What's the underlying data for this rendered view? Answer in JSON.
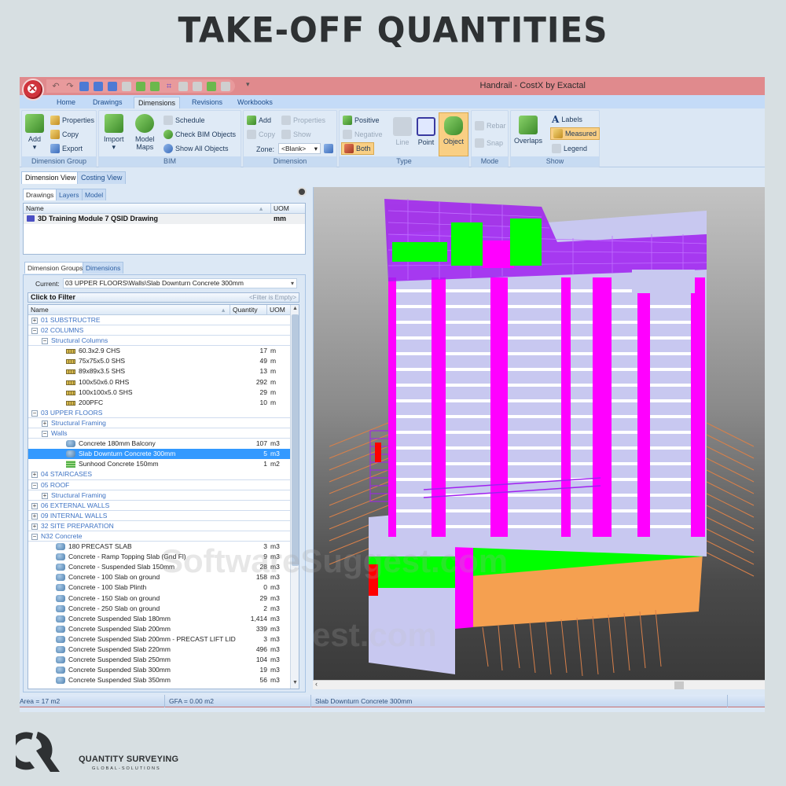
{
  "page": {
    "title": "TAKE-OFF QUANTITIES",
    "logo_name": "QUANTITY SURVEYING",
    "logo_sub": "GLOBAL-SOLUTIONS",
    "watermark": "SoftwareSuggest.com"
  },
  "app": {
    "window_title": "Handrail - CostX by Exactal",
    "quick_access_icons": [
      "undo-icon",
      "redo-icon",
      "delete-drawing-icon",
      "open-drawing-icon",
      "import-icon",
      "rotate-icon",
      "add-dimension-icon",
      "add-group-icon",
      "polygon-icon",
      "line-icon",
      "new-icon",
      "open-icon",
      "customize-icon"
    ],
    "ribbon_tabs": [
      {
        "label": "Home",
        "active": false
      },
      {
        "label": "Drawings",
        "active": false
      },
      {
        "label": "Dimensions",
        "active": true
      },
      {
        "label": "Revisions",
        "active": false
      },
      {
        "label": "Workbooks",
        "active": false
      }
    ],
    "ribbon_groups": {
      "dimension_group": {
        "label": "Dimension Group",
        "add": "Add",
        "properties": "Properties",
        "copy": "Copy",
        "export": "Export"
      },
      "bim": {
        "label": "BIM",
        "import": "Import",
        "model_maps_1": "Model",
        "model_maps_2": "Maps",
        "schedule": "Schedule",
        "check_bim": "Check BIM Objects",
        "show_all": "Show All Objects"
      },
      "dimension": {
        "label": "Dimension",
        "add": "Add",
        "properties": "Properties",
        "copy": "Copy",
        "show": "Show",
        "zone_label": "Zone:",
        "zone_value": "<Blank>"
      },
      "type": {
        "label": "Type",
        "positive": "Positive",
        "negative": "Negative",
        "both": "Both",
        "line": "Line",
        "point": "Point",
        "object": "Object"
      },
      "mode": {
        "label": "Mode",
        "rebar": "Rebar",
        "snap": "Snap"
      },
      "show": {
        "label": "Show",
        "overlaps": "Overlaps",
        "labels": "Labels",
        "measured": "Measured",
        "legend": "Legend"
      }
    },
    "view_tabs": [
      {
        "label": "Dimension View",
        "active": true
      },
      {
        "label": "Costing View",
        "active": false
      }
    ],
    "drawings_panel": {
      "tabs": [
        {
          "label": "Drawings",
          "active": true
        },
        {
          "label": "Layers",
          "active": false
        },
        {
          "label": "Model",
          "active": false
        }
      ],
      "columns": {
        "name": "Name",
        "uom": "UOM"
      },
      "rows": [
        {
          "name": "3D Training Module 7 QSID Drawing",
          "uom": "mm"
        }
      ]
    },
    "groups_panel": {
      "tabs": [
        {
          "label": "Dimension Groups",
          "active": true
        },
        {
          "label": "Dimensions",
          "active": false
        }
      ],
      "current_label": "Current:",
      "current_value": "03 UPPER FLOORS\\Walls\\Slab Downturn Concrete 300mm",
      "filter_label": "Click to Filter",
      "filter_status": "<Filter is Empty>",
      "columns": {
        "name": "Name",
        "quantity": "Quantity",
        "uom": "UOM"
      },
      "rows": [
        {
          "level": 0,
          "type": "group",
          "expander": "+",
          "name": "01 SUBSTRUCTRE"
        },
        {
          "level": 0,
          "type": "group",
          "expander": "-",
          "name": "02 COLUMNS"
        },
        {
          "level": 1,
          "type": "group",
          "expander": "-",
          "name": "Structural Columns"
        },
        {
          "level": 2,
          "type": "item",
          "icon": "beam",
          "name": "60.3x2.9 CHS",
          "quantity": "17",
          "uom": "m"
        },
        {
          "level": 2,
          "type": "item",
          "icon": "beam",
          "name": "75x75x5.0 SHS",
          "quantity": "49",
          "uom": "m"
        },
        {
          "level": 2,
          "type": "item",
          "icon": "beam",
          "name": "89x89x3.5 SHS",
          "quantity": "13",
          "uom": "m"
        },
        {
          "level": 2,
          "type": "item",
          "icon": "beam",
          "name": "100x50x6.0 RHS",
          "quantity": "292",
          "uom": "m"
        },
        {
          "level": 2,
          "type": "item",
          "icon": "beam",
          "name": "100x100x5.0 SHS",
          "quantity": "29",
          "uom": "m"
        },
        {
          "level": 2,
          "type": "item",
          "icon": "beam",
          "name": "200PFC",
          "quantity": "10",
          "uom": "m"
        },
        {
          "level": 0,
          "type": "group",
          "expander": "-",
          "name": "03 UPPER FLOORS"
        },
        {
          "level": 1,
          "type": "group",
          "expander": "+",
          "name": "Structural Framing"
        },
        {
          "level": 1,
          "type": "group",
          "expander": "-",
          "name": "Walls"
        },
        {
          "level": 2,
          "type": "item",
          "icon": "cube",
          "name": "Concrete 180mm Balcony",
          "quantity": "107",
          "uom": "m3"
        },
        {
          "level": 2,
          "type": "item",
          "icon": "cube",
          "name": "Slab Downturn Concrete 300mm",
          "quantity": "5",
          "uom": "m3",
          "selected": true
        },
        {
          "level": 2,
          "type": "item",
          "icon": "grid",
          "name": "Sunhood Concrete 150mm",
          "quantity": "1",
          "uom": "m2"
        },
        {
          "level": 0,
          "type": "group",
          "expander": "+",
          "name": "04 STAIRCASES"
        },
        {
          "level": 0,
          "type": "group",
          "expander": "-",
          "name": "05 ROOF"
        },
        {
          "level": 1,
          "type": "group",
          "expander": "+",
          "name": "Structural Framing"
        },
        {
          "level": 0,
          "type": "group",
          "expander": "+",
          "name": "06 EXTERNAL WALLS"
        },
        {
          "level": 0,
          "type": "group",
          "expander": "+",
          "name": "09 INTERNAL WALLS"
        },
        {
          "level": 0,
          "type": "group",
          "expander": "+",
          "name": "32 SITE PREPARATION"
        },
        {
          "level": 0,
          "type": "group",
          "expander": "-",
          "name": "N32 Concrete"
        },
        {
          "level": 1,
          "type": "item",
          "icon": "cube",
          "name": "180 PRECAST SLAB",
          "quantity": "3",
          "uom": "m3"
        },
        {
          "level": 1,
          "type": "item",
          "icon": "cube",
          "name": "Concrete - Ramp Topping Slab (Gnd Fl)",
          "quantity": "9",
          "uom": "m3"
        },
        {
          "level": 1,
          "type": "item",
          "icon": "cube",
          "name": "Concrete - Suspended Slab 150mm",
          "quantity": "28",
          "uom": "m3"
        },
        {
          "level": 1,
          "type": "item",
          "icon": "cube",
          "name": "Concrete - 100 Slab on ground",
          "quantity": "158",
          "uom": "m3"
        },
        {
          "level": 1,
          "type": "item",
          "icon": "cube",
          "name": "Concrete - 100 Slab Plinth",
          "quantity": "0",
          "uom": "m3"
        },
        {
          "level": 1,
          "type": "item",
          "icon": "cube",
          "name": "Concrete - 150 Slab on ground",
          "quantity": "29",
          "uom": "m3"
        },
        {
          "level": 1,
          "type": "item",
          "icon": "cube",
          "name": "Concrete - 250 Slab on ground",
          "quantity": "2",
          "uom": "m3"
        },
        {
          "level": 1,
          "type": "item",
          "icon": "cube",
          "name": "Concrete Suspended Slab 180mm",
          "quantity": "1,414",
          "uom": "m3"
        },
        {
          "level": 1,
          "type": "item",
          "icon": "cube",
          "name": "Concrete Suspended Slab 200mm",
          "quantity": "339",
          "uom": "m3"
        },
        {
          "level": 1,
          "type": "item",
          "icon": "cube",
          "name": "Concrete Suspended Slab 200mm - PRECAST LIFT LID",
          "quantity": "3",
          "uom": "m3"
        },
        {
          "level": 1,
          "type": "item",
          "icon": "cube",
          "name": "Concrete Suspended Slab 220mm",
          "quantity": "496",
          "uom": "m3"
        },
        {
          "level": 1,
          "type": "item",
          "icon": "cube",
          "name": "Concrete Suspended Slab 250mm",
          "quantity": "104",
          "uom": "m3"
        },
        {
          "level": 1,
          "type": "item",
          "icon": "cube",
          "name": "Concrete Suspended Slab 300mm",
          "quantity": "19",
          "uom": "m3"
        },
        {
          "level": 1,
          "type": "item",
          "icon": "cube",
          "name": "Concrete Suspended Slab 350mm",
          "quantity": "56",
          "uom": "m3"
        }
      ]
    },
    "status": {
      "area": "Area = 17 m2",
      "gfa": "GFA = 0.00 m2",
      "selected": "Slab Downturn Concrete 300mm"
    },
    "colors": {
      "titlebar": "#e08a8d",
      "selection": "#3399ff",
      "model_magenta": "#ff00ff",
      "model_purple": "#a020f0",
      "model_green": "#00ff00",
      "model_lavender": "#c8c8f0",
      "model_orange": "#f5a050",
      "model_red": "#ff0000"
    }
  }
}
